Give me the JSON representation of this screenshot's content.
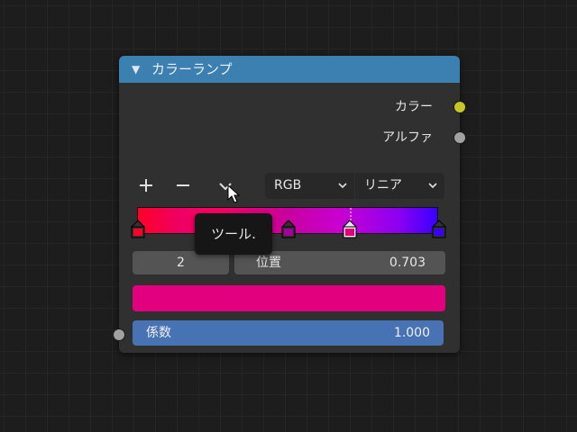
{
  "node": {
    "title": "カラーランプ",
    "outputs": [
      {
        "label": "カラー",
        "socket_color": "#c7c729"
      },
      {
        "label": "アルファ",
        "socket_color": "#a1a1a1"
      }
    ],
    "toolbar": {
      "add_icon": "plus-icon",
      "remove_icon": "minus-icon",
      "menu_icon": "chevron-down-icon"
    },
    "color_mode": "RGB",
    "interpolation": "リニア",
    "ramp": {
      "stops": [
        {
          "position": 0.0,
          "color": "#ff0026"
        },
        {
          "position": 0.5,
          "color": "#c8009e"
        },
        {
          "position": 0.703,
          "color": "#e2007f"
        },
        {
          "position": 1.0,
          "color": "#3800ff"
        }
      ],
      "active_stop_position": 0.703
    },
    "active_index": "2",
    "position_label": "位置",
    "position_value": "0.703",
    "active_color": "#e2007f",
    "factor_label": "係数",
    "factor_value": "1.000",
    "input_socket_color": "#a1a1a1"
  },
  "tooltip": {
    "text": "ツール."
  },
  "colors": {
    "header": "#3c7fb1",
    "node_body": "#303030",
    "factor_field": "#4772b3"
  }
}
